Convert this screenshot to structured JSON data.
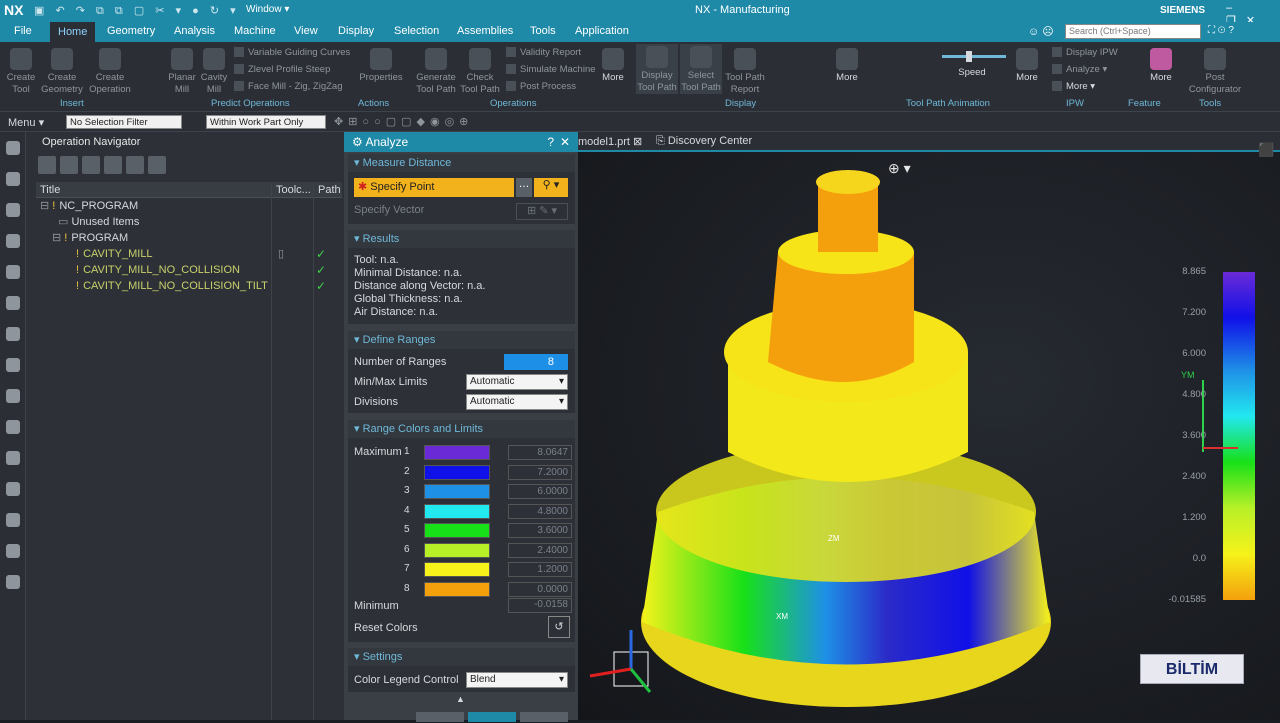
{
  "titlebar": {
    "logo": "NX",
    "window_menu": "Window ▾",
    "title": "NX - Manufacturing",
    "brand": "SIEMENS"
  },
  "menu": {
    "tabs": [
      "File",
      "Home",
      "Geometry",
      "Analysis",
      "Machine",
      "View",
      "Display",
      "Selection",
      "Assemblies",
      "Tools",
      "Application"
    ],
    "search_placeholder": "Search (Ctrl+Space)"
  },
  "ribbon": {
    "create_tool": "Create Tool",
    "create_geometry": "Create Geometry",
    "create_operation": "Create Operation",
    "planar_mill": "Planar Mill",
    "cavity_mill": "Cavity Mill",
    "variable_guiding": "Variable Guiding Curves",
    "zlevel": "Zlevel Profile Steep",
    "face_mill": "Face Mill - Zig, ZigZag",
    "properties": "Properties",
    "generate": "Generate Tool Path",
    "check": "Check Tool Path",
    "validity": "Validity Report",
    "simulate": "Simulate Machine",
    "post_process": "Post Process",
    "more1": "More",
    "display_tool_path": "Display Tool Path",
    "select_tool_path": "Select Tool Path",
    "tool_path_report": "Tool Path Report",
    "more2": "More",
    "speed": "Speed",
    "more3": "More",
    "display_ipw": "Display IPW",
    "analyze": "Analyze",
    "more4": "More",
    "more5": "More",
    "post_configurator": "Post Configurator",
    "groups": {
      "insert": "Insert",
      "predict": "Predict Operations",
      "actions": "Actions",
      "operations": "Operations",
      "display": "Display",
      "animation": "Tool Path Animation",
      "ipw": "IPW",
      "feature": "Feature",
      "tools": "Tools"
    }
  },
  "toolbar": {
    "menu": "Menu ▾",
    "filter": "No Selection Filter",
    "scope": "Within Work Part Only"
  },
  "navigator": {
    "title": "Operation Navigator",
    "col_title": "Title",
    "col_toolchange": "Toolc...",
    "col_path": "Path",
    "rows": [
      {
        "label": "NC_PROGRAM",
        "indent": 0
      },
      {
        "label": "Unused Items",
        "indent": 1
      },
      {
        "label": "PROGRAM",
        "indent": 1
      },
      {
        "label": "CAVITY_MILL",
        "indent": 2,
        "ok": "✓"
      },
      {
        "label": "CAVITY_MILL_NO_COLLISION",
        "indent": 2,
        "ok": "✓"
      },
      {
        "label": "CAVITY_MILL_NO_COLLISION_TILT",
        "indent": 2,
        "ok": "✓"
      }
    ]
  },
  "analyze": {
    "title": "Analyze",
    "help": "?",
    "close": "✕",
    "measure_distance": "Measure Distance",
    "specify_point": "Specify Point",
    "specify_vector": "Specify Vector",
    "results_title": "Results",
    "results": [
      "Tool: n.a.",
      "Minimal Distance: n.a.",
      "Distance along Vector: n.a.",
      "Global Thickness: n.a.",
      "Air Distance: n.a."
    ],
    "define_ranges": "Define Ranges",
    "num_ranges_label": "Number of Ranges",
    "num_ranges": "8",
    "minmax_label": "Min/Max Limits",
    "minmax": "Automatic",
    "divisions_label": "Divisions",
    "divisions": "Automatic",
    "range_colors": "Range Colors and Limits",
    "maximum": "Maximum",
    "minimum": "Minimum",
    "minimum_value": "-0.0158",
    "ranges": [
      {
        "n": "1",
        "color": "#6a2bd6",
        "value": "8.0647"
      },
      {
        "n": "2",
        "color": "#1010e8",
        "value": "7.2000"
      },
      {
        "n": "3",
        "color": "#1e90e6",
        "value": "6.0000"
      },
      {
        "n": "4",
        "color": "#22e8f0",
        "value": "4.8000"
      },
      {
        "n": "5",
        "color": "#18e018",
        "value": "3.6000"
      },
      {
        "n": "6",
        "color": "#b8f028",
        "value": "2.4000"
      },
      {
        "n": "7",
        "color": "#f6f21a",
        "value": "1.2000"
      },
      {
        "n": "8",
        "color": "#f4a00c",
        "value": "0.0000"
      }
    ],
    "reset_colors": "Reset Colors",
    "settings": "Settings",
    "legend_control_label": "Color Legend Control",
    "legend_control": "Blend"
  },
  "tabs": {
    "model": "model1.prt",
    "discovery": "Discovery Center"
  },
  "legend": {
    "labels": [
      "8.865",
      "7.200",
      "6.000",
      "4.800",
      "3.600",
      "2.400",
      "1.200",
      "0.0",
      "-0.01585"
    ]
  },
  "axes": {
    "ym": "YM",
    "xm": "XM",
    "zm": "ZM"
  },
  "watermark": "BİLTİM"
}
